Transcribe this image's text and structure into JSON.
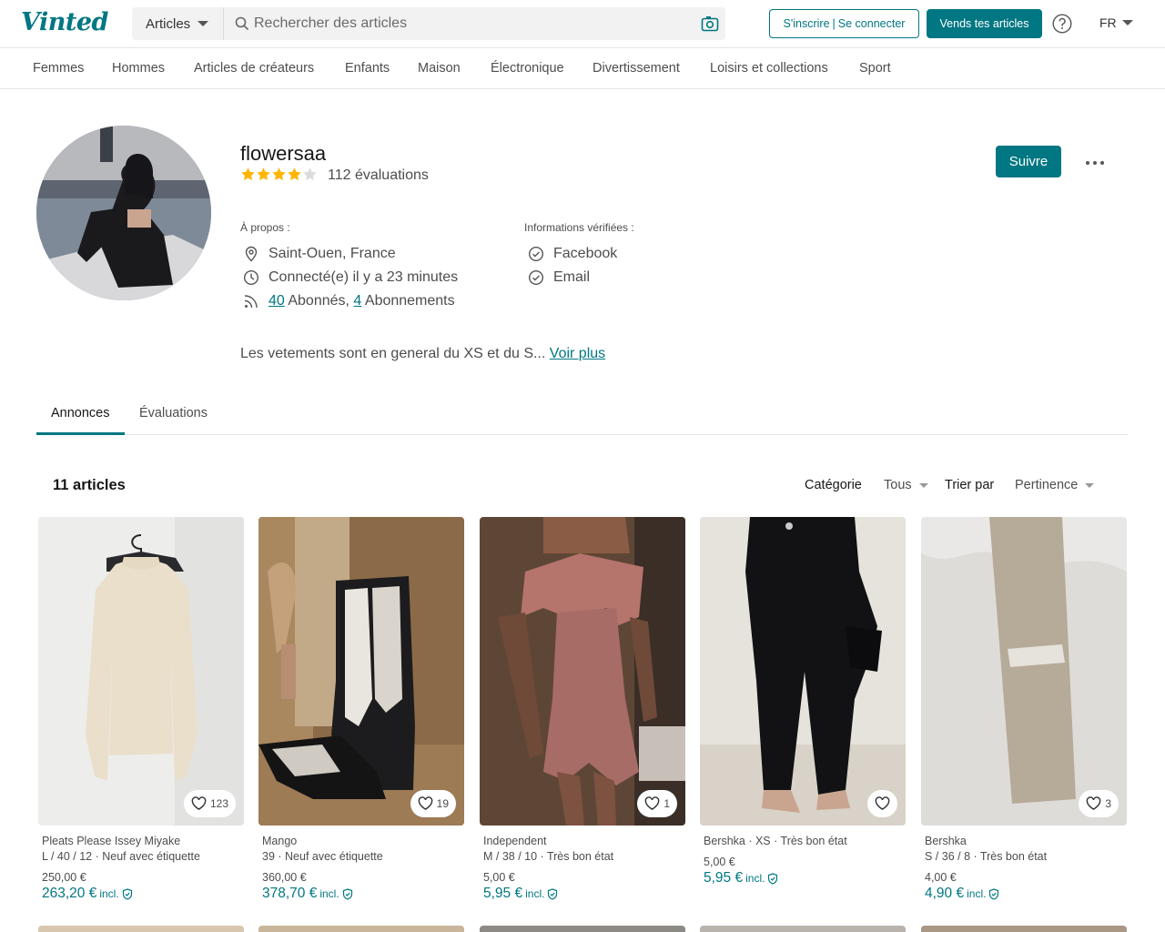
{
  "header": {
    "logo": "Vinted",
    "search_category": "Articles",
    "search_placeholder": "Rechercher des articles",
    "auth_signup": "S'inscrire",
    "auth_login": "Se connecter",
    "sell_button": "Vends tes articles",
    "language": "FR"
  },
  "categories": [
    "Femmes",
    "Hommes",
    "Articles de créateurs",
    "Enfants",
    "Maison",
    "Électronique",
    "Divertissement",
    "Loisirs et collections",
    "Sport"
  ],
  "profile": {
    "username": "flowersaa",
    "rating_stars": 4,
    "rating_max": 5,
    "evaluations": "112 évaluations",
    "follow_button": "Suivre",
    "about_label": "À propos :",
    "location": "Saint-Ouen, France",
    "last_seen": "Connecté(e) il y a 23 minutes",
    "followers_count": "40",
    "followers_label": " Abonnés, ",
    "following_count": "4",
    "following_label": " Abonnements",
    "verified_label": "Informations vérifiées :",
    "verified": [
      "Facebook",
      "Email"
    ],
    "bio": "Les vetements sont en general du XS et du S...",
    "bio_more": "Voir plus"
  },
  "tabs": [
    "Annonces",
    "Évaluations"
  ],
  "listing": {
    "count": "11 articles",
    "category_label": "Catégorie",
    "category_value": "Tous",
    "sort_label": "Trier par",
    "sort_value": "Pertinence"
  },
  "items": [
    {
      "brand": "Pleats Please Issey Miyake",
      "sub": "L / 40 / 12 · Neuf avec étiquette",
      "price": "250,00 €",
      "total": "263,20 €",
      "incl": "incl.",
      "likes": "123"
    },
    {
      "brand": "Mango",
      "sub": "39 · Neuf avec étiquette",
      "price": "360,00 €",
      "total": "378,70 €",
      "incl": "incl.",
      "likes": "19"
    },
    {
      "brand": "Independent",
      "sub": "M / 38 / 10 · Très bon état",
      "price": "5,00 €",
      "total": "5,95 €",
      "incl": "incl.",
      "likes": "1"
    },
    {
      "brand": "Bershka · XS · Très bon état",
      "sub": "",
      "price": "5,00 €",
      "total": "5,95 €",
      "incl": "incl.",
      "likes": ""
    },
    {
      "brand": "Bershka",
      "sub": "S / 36 / 8 · Très bon état",
      "price": "4,00 €",
      "total": "4,90 €",
      "incl": "incl.",
      "likes": "3"
    }
  ],
  "colors": {
    "accent": "#007782",
    "text": "#171717",
    "muted": "#4d4d4d",
    "star": "#ffb400"
  }
}
